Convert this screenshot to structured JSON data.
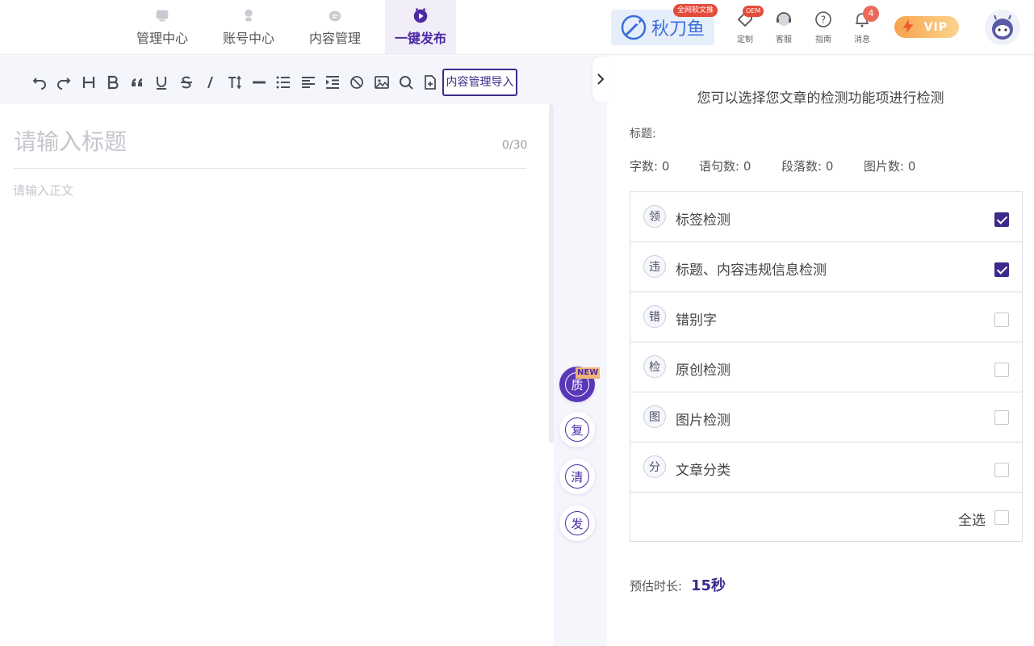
{
  "nav": {
    "tabs": [
      {
        "label": "管理中心",
        "icon": "monitor-icon"
      },
      {
        "label": "账号中心",
        "icon": "user-icon"
      },
      {
        "label": "内容管理",
        "icon": "content-icon"
      },
      {
        "label": "一键发布",
        "icon": "publish-icon",
        "active": true
      }
    ]
  },
  "brand": {
    "name": "秋刀鱼",
    "badge": "全网软文推"
  },
  "utils": {
    "custom": {
      "label": "定制",
      "badge": "OEM"
    },
    "service": {
      "label": "客服"
    },
    "guide": {
      "label": "指南"
    },
    "messages": {
      "label": "消息",
      "count": "4"
    }
  },
  "vip": {
    "label": "VIP"
  },
  "toolbar": {
    "buttons": [
      "undo-icon",
      "redo-icon",
      "heading-icon",
      "bold-icon",
      "quote-icon",
      "underline-icon",
      "strikethrough-icon",
      "italic-icon",
      "font-size-icon",
      "horizontal-rule-icon",
      "bullet-list-icon",
      "align-left-icon",
      "indent-icon",
      "clear-format-icon",
      "image-icon",
      "search-icon",
      "insert-file-icon"
    ],
    "import_label": "内容管理导入"
  },
  "editor": {
    "title_placeholder": "请输入标题",
    "title_count": "0/30",
    "body_placeholder": "请输入正文"
  },
  "side_actions": [
    {
      "char": "质",
      "tag": "NEW"
    },
    {
      "char": "复"
    },
    {
      "char": "清"
    },
    {
      "char": "发"
    }
  ],
  "panel": {
    "heading": "您可以选择您文章的检测功能项进行检测",
    "title_label": "标题:",
    "stats": [
      {
        "label": "字数:",
        "value": "0"
      },
      {
        "label": "语句数:",
        "value": "0"
      },
      {
        "label": "段落数:",
        "value": "0"
      },
      {
        "label": "图片数:",
        "value": "0"
      }
    ],
    "checks": [
      {
        "icon_char": "领",
        "label": "标签检测",
        "checked": true
      },
      {
        "icon_char": "违",
        "label": "标题、内容违规信息检测",
        "checked": true
      },
      {
        "icon_char": "错",
        "label": "错别字",
        "checked": false
      },
      {
        "icon_char": "检",
        "label": "原创检测",
        "checked": false
      },
      {
        "icon_char": "图",
        "label": "图片检测",
        "checked": false
      },
      {
        "icon_char": "分",
        "label": "文章分类",
        "checked": false
      }
    ],
    "select_all_label": "全选",
    "duration_label": "预估时长:",
    "duration_value": "15秒"
  },
  "colors": {
    "accent": "#3e2a8c",
    "accent_light": "#f1eef9",
    "badge_red": "#e44b3a",
    "vip_orange": "#f6a44c"
  }
}
